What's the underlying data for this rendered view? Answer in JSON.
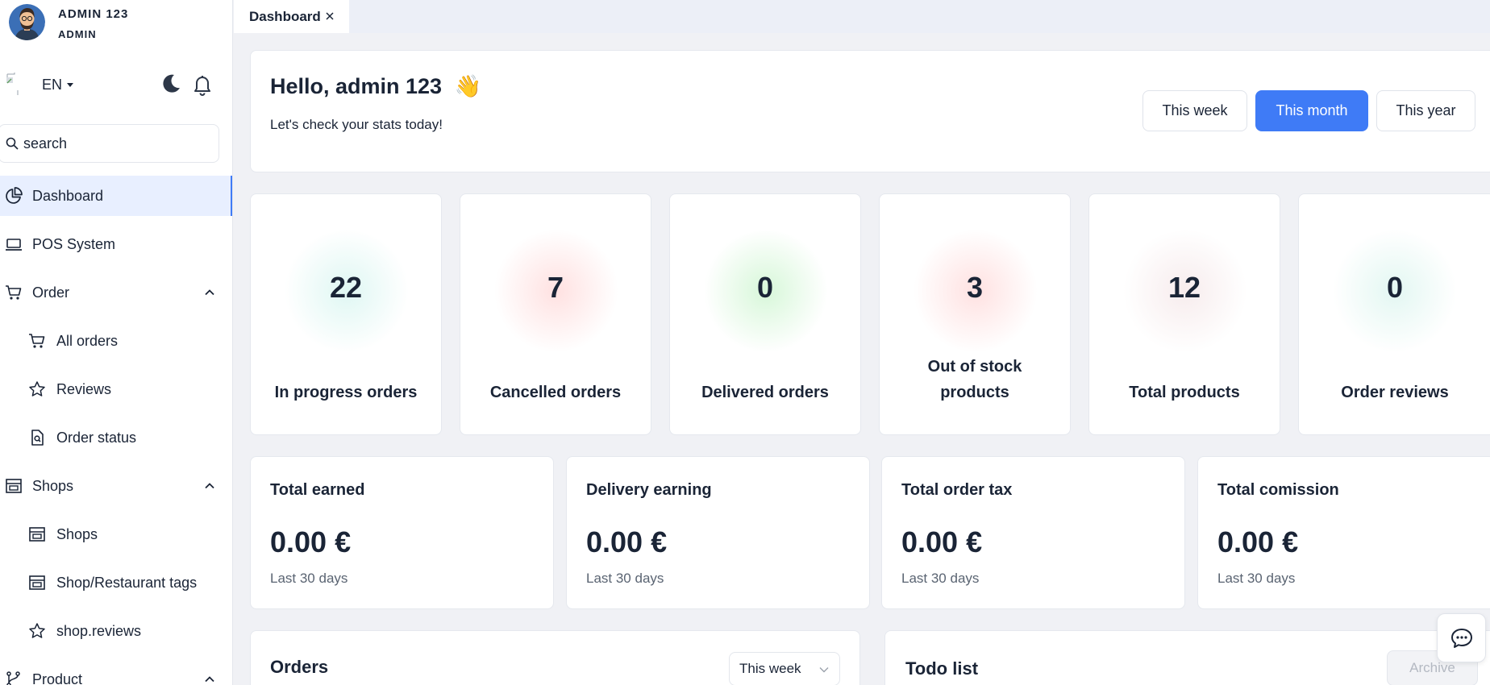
{
  "user": {
    "name": "ADMIN 123",
    "role": "ADMIN"
  },
  "header": {
    "language": "EN"
  },
  "search": {
    "placeholder": "search"
  },
  "sidebar": {
    "items": [
      {
        "label": "Dashboard"
      },
      {
        "label": "POS System"
      },
      {
        "label": "Order"
      },
      {
        "label": "All orders"
      },
      {
        "label": "Reviews"
      },
      {
        "label": "Order status"
      },
      {
        "label": "Shops"
      },
      {
        "label": "Shops"
      },
      {
        "label": "Shop/Restaurant tags"
      },
      {
        "label": "shop.reviews"
      },
      {
        "label": "Product"
      }
    ]
  },
  "tabs": [
    {
      "label": "Dashboard"
    }
  ],
  "hello": {
    "title": "Hello, admin 123",
    "emoji": "👋",
    "subtitle": "Let's check your stats today!"
  },
  "period": {
    "week": "This week",
    "month": "This month",
    "year": "This year",
    "selected": "This month"
  },
  "stats": [
    {
      "value": "22",
      "label": "In progress orders",
      "glow": "#dff7f3"
    },
    {
      "value": "7",
      "label": "Cancelled orders",
      "glow": "#ffe1e1"
    },
    {
      "value": "0",
      "label": "Delivered orders",
      "glow": "#d7f7d9"
    },
    {
      "value": "3",
      "label": "Out of stock products",
      "line1": "Out of stock",
      "line2": "products",
      "glow": "#ffe1e1"
    },
    {
      "value": "12",
      "label": "Total products",
      "glow": "#f7eced"
    },
    {
      "value": "0",
      "label": "Order reviews",
      "glow": "#e3f7f2"
    }
  ],
  "earnings": [
    {
      "title": "Total earned",
      "value": "0.00 €",
      "sub": "Last 30 days"
    },
    {
      "title": "Delivery earning",
      "value": "0.00 €",
      "sub": "Last 30 days"
    },
    {
      "title": "Total order tax",
      "value": "0.00 €",
      "sub": "Last 30 days"
    },
    {
      "title": "Total comission",
      "value": "0.00 €",
      "sub": "Last 30 days"
    }
  ],
  "orders": {
    "title": "Orders",
    "filter": "This week"
  },
  "todo": {
    "title": "Todo list",
    "archive": "Archive"
  },
  "colors": {
    "accent": "#3f7bf6",
    "text": "#1a2436",
    "background": "#f0f1f5"
  }
}
